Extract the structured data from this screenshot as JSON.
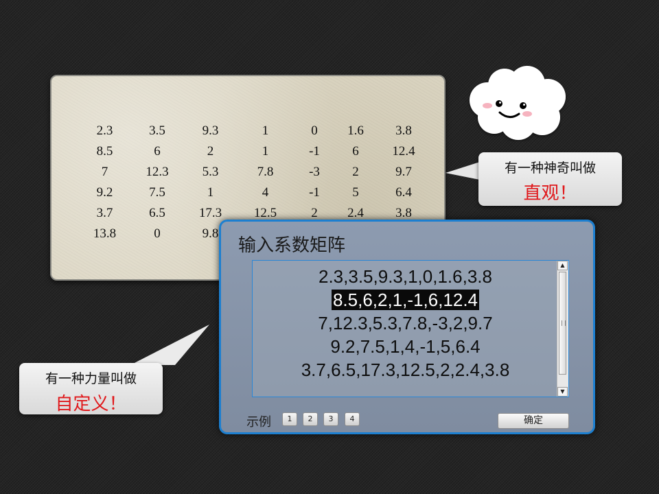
{
  "matrix_panel": {
    "rows": [
      [
        "2.3",
        "3.5",
        "9.3",
        "1",
        "0",
        "1.6",
        "3.8"
      ],
      [
        "8.5",
        "6",
        "2",
        "1",
        "-1",
        "6",
        "12.4"
      ],
      [
        "7",
        "12.3",
        "5.3",
        "7.8",
        "-3",
        "2",
        "9.7"
      ],
      [
        "9.2",
        "7.5",
        "1",
        "4",
        "-1",
        "5",
        "6.4"
      ],
      [
        "3.7",
        "6.5",
        "17.3",
        "12.5",
        "2",
        "2.4",
        "3.8"
      ],
      [
        "13.8",
        "0",
        "9.8",
        "",
        "",
        "",
        ""
      ]
    ]
  },
  "callout_top": {
    "line1": "有一种神奇叫做",
    "line2": "直观！"
  },
  "callout_bottom": {
    "line1": "有一种力量叫做",
    "line2": "自定义！"
  },
  "dialog": {
    "title": "输入系数矩阵",
    "lines": [
      "2.3,3.5,9.3,1,0,1.6,3.8",
      "8.5,6,2,1,-1,6,12.4",
      "7,12.3,5.3,7.8,-3,2,9.7",
      "9.2,7.5,1,4,-1,5,6.4",
      "3.7,6.5,17.3,12.5,2,2.4,3.8"
    ],
    "examples_label": "示例",
    "example_buttons": [
      "1",
      "2",
      "3",
      "4"
    ],
    "ok_label": "确定"
  },
  "colors": {
    "accent_red": "#e0181b",
    "dialog_border": "#1c7fd0"
  }
}
